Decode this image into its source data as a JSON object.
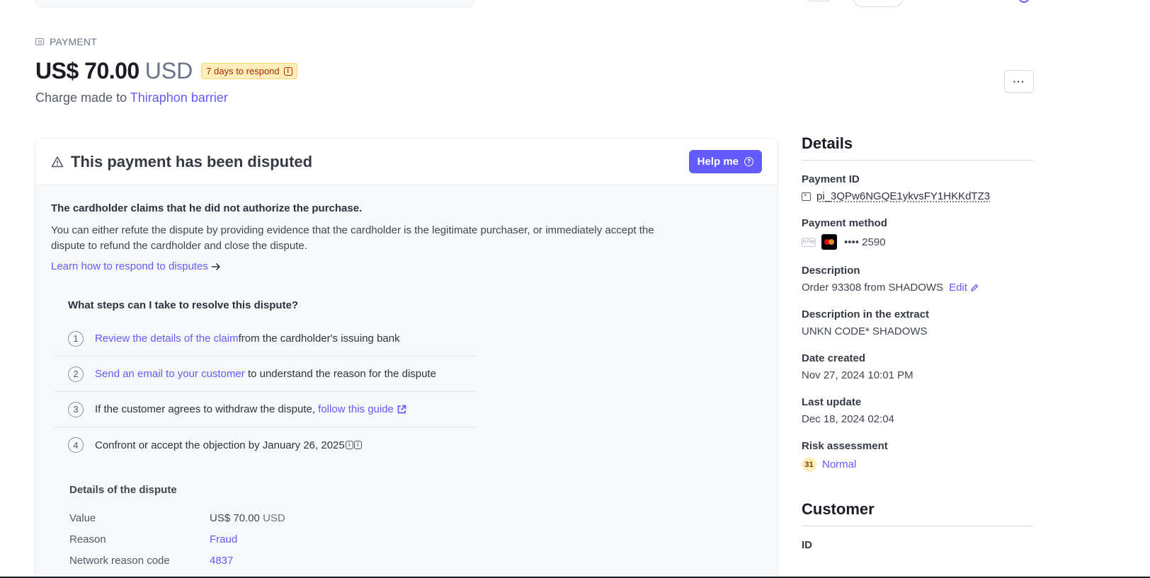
{
  "header": {
    "crumb": "PAYMENT",
    "amount": "US$ 70.00",
    "currency": "USD",
    "badge": "7 days to respond",
    "charge_prefix": "Charge made to",
    "customer_link": "Thiraphon barrier",
    "more_label": "···"
  },
  "dispute": {
    "title": "This payment has been disputed",
    "help_label": "Help me",
    "claim_title": "The cardholder claims that he did not authorize the purchase.",
    "claim_text": "You can either refute the dispute by providing evidence that the cardholder is the legitimate purchaser, or immediately accept the dispute to refund the cardholder and close the dispute.",
    "learn_link": "Learn how to respond to disputes",
    "steps_title": "What steps can I take to resolve this dispute?",
    "steps": [
      {
        "num": "1",
        "link": "Review the details of the claim",
        "text": "from the cardholder's issuing bank"
      },
      {
        "num": "2",
        "link": "Send an email to your customer",
        "text": " to understand the reason for the dispute"
      },
      {
        "num": "3",
        "prefix": "If the customer agrees to withdraw the dispute, ",
        "link": "follow this guide"
      },
      {
        "num": "4",
        "text": "Confront or accept the objection by January 26, 2025"
      }
    ],
    "details_title": "Details of the dispute",
    "details": [
      {
        "label": "Value",
        "amount": "US$ 70.00",
        "currency": "USD"
      },
      {
        "label": "Reason",
        "value": "Fraud"
      },
      {
        "label": "Network reason code",
        "value": "4837"
      }
    ]
  },
  "side": {
    "details_heading": "Details",
    "payment_id_label": "Payment ID",
    "payment_id": "pi_3QPw6NGQE1ykvsFY1HKKdTZ3",
    "payment_method_label": "Payment method",
    "gpay_label": "G Pay",
    "card_last4": "•••• 2590",
    "description_label": "Description",
    "description": "Order 93308 from SHADOWS",
    "edit_label": "Edit",
    "extract_label": "Description in the extract",
    "extract": "UNKN CODE* SHADOWS",
    "date_created_label": "Date created",
    "date_created": "Nov 27, 2024 10:01 PM",
    "last_update_label": "Last update",
    "last_update": "Dec 18, 2024 02:04",
    "risk_label": "Risk assessment",
    "risk_score": "31",
    "risk_level": "Normal",
    "customer_heading": "Customer",
    "id_label": "ID"
  },
  "colors": {
    "accent": "#635bff",
    "badge_bg": "#fcedb9",
    "badge_text": "#a82c00",
    "card_bg": "#f6f8fa"
  }
}
